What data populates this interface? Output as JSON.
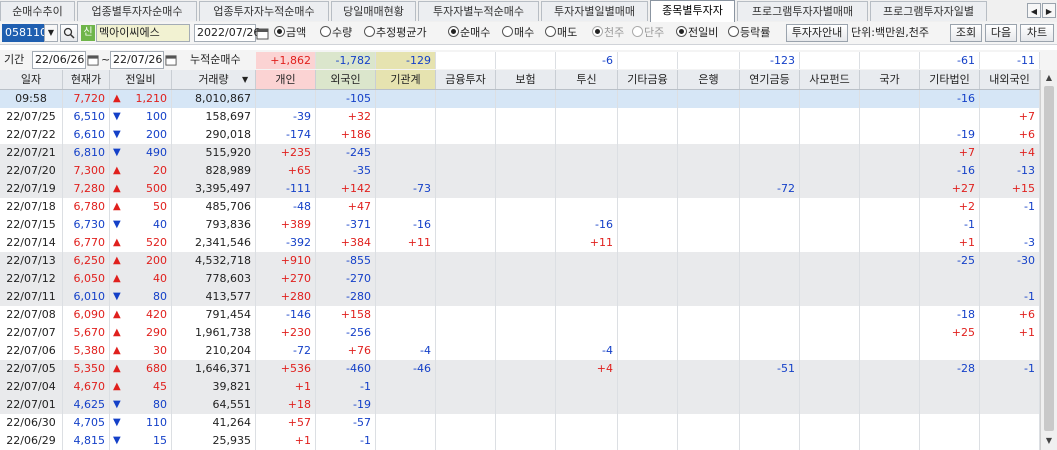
{
  "tabs": [
    "순매수추이",
    "업종별투자자순매수",
    "업종투자자누적순매수",
    "당일매매현황",
    "투자자별누적순매수",
    "투자자별일별매매",
    "종목별투자자",
    "프로그램투자자별매매",
    "프로그램투자자일별"
  ],
  "active_tab": 6,
  "toolbar": {
    "stock_code": "058110",
    "stock_badge": "신",
    "stock_name": "멕아이씨에스",
    "date": "2022/07/26",
    "opt1": [
      "금액",
      "수량",
      "추정평균가"
    ],
    "opt2": [
      "순매수",
      "매수",
      "매도"
    ],
    "opt3": [
      "천주",
      "단주"
    ],
    "opt4": [
      "전일비",
      "등락률"
    ],
    "investor_info_btn": "투자자안내",
    "unit_label": "단위:백만원,천주",
    "query_btn": "조회",
    "next_btn": "다음",
    "chart_btn": "차트"
  },
  "period": {
    "label": "기간",
    "from": "22/06/26",
    "to": "22/07/26",
    "cum_label": "누적순매수",
    "sums": [
      "+1,862",
      "-1,782",
      "-129",
      "",
      "",
      "-6",
      "",
      "",
      "-123",
      "",
      "",
      "-61",
      "-11"
    ]
  },
  "columns": [
    "일자",
    "현재가",
    "전일비",
    "거래량",
    "개인",
    "외국인",
    "기관계",
    "금융투자",
    "보험",
    "투신",
    "기타금융",
    "은행",
    "연기금등",
    "사모펀드",
    "국가",
    "기타법인",
    "내외국인"
  ],
  "accent": {
    "up": "#e0201d",
    "down": "#1440c8",
    "highlight": "#d6e6f6",
    "shade": "#e9eaec"
  },
  "rows": [
    {
      "date": "09:58",
      "price": "7,720",
      "dir": "up",
      "chg": "1,210",
      "vol": "8,010,867",
      "vals": [
        "",
        "-105",
        "",
        "",
        "",
        "",
        "",
        "",
        "",
        "",
        "",
        "-16",
        ""
      ]
    },
    {
      "date": "22/07/25",
      "price": "6,510",
      "dir": "down",
      "chg": "100",
      "vol": "158,697",
      "vals": [
        "-39",
        "+32",
        "",
        "",
        "",
        "",
        "",
        "",
        "",
        "",
        "",
        "",
        "+7"
      ]
    },
    {
      "date": "22/07/22",
      "price": "6,610",
      "dir": "down",
      "chg": "200",
      "vol": "290,018",
      "vals": [
        "-174",
        "+186",
        "",
        "",
        "",
        "",
        "",
        "",
        "",
        "",
        "",
        "-19",
        "+6"
      ]
    },
    {
      "date": "22/07/21",
      "price": "6,810",
      "dir": "down",
      "chg": "490",
      "vol": "515,920",
      "vals": [
        "+235",
        "-245",
        "",
        "",
        "",
        "",
        "",
        "",
        "",
        "",
        "",
        "+7",
        "+4"
      ]
    },
    {
      "date": "22/07/20",
      "price": "7,300",
      "dir": "up",
      "chg": "20",
      "vol": "828,989",
      "vals": [
        "+65",
        "-35",
        "",
        "",
        "",
        "",
        "",
        "",
        "",
        "",
        "",
        "-16",
        "-13"
      ]
    },
    {
      "date": "22/07/19",
      "price": "7,280",
      "dir": "up",
      "chg": "500",
      "vol": "3,395,497",
      "vals": [
        "-111",
        "+142",
        "-73",
        "",
        "",
        "",
        "",
        "",
        "-72",
        "",
        "",
        "+27",
        "+15"
      ]
    },
    {
      "date": "22/07/18",
      "price": "6,780",
      "dir": "up",
      "chg": "50",
      "vol": "485,706",
      "vals": [
        "-48",
        "+47",
        "",
        "",
        "",
        "",
        "",
        "",
        "",
        "",
        "",
        "+2",
        "-1"
      ]
    },
    {
      "date": "22/07/15",
      "price": "6,730",
      "dir": "down",
      "chg": "40",
      "vol": "793,836",
      "vals": [
        "+389",
        "-371",
        "-16",
        "",
        "",
        "-16",
        "",
        "",
        "",
        "",
        "",
        "-1",
        ""
      ]
    },
    {
      "date": "22/07/14",
      "price": "6,770",
      "dir": "up",
      "chg": "520",
      "vol": "2,341,546",
      "vals": [
        "-392",
        "+384",
        "+11",
        "",
        "",
        "+11",
        "",
        "",
        "",
        "",
        "",
        "+1",
        "-3"
      ]
    },
    {
      "date": "22/07/13",
      "price": "6,250",
      "dir": "up",
      "chg": "200",
      "vol": "4,532,718",
      "vals": [
        "+910",
        "-855",
        "",
        "",
        "",
        "",
        "",
        "",
        "",
        "",
        "",
        "-25",
        "-30"
      ]
    },
    {
      "date": "22/07/12",
      "price": "6,050",
      "dir": "up",
      "chg": "40",
      "vol": "778,603",
      "vals": [
        "+270",
        "-270",
        "",
        "",
        "",
        "",
        "",
        "",
        "",
        "",
        "",
        "",
        ""
      ]
    },
    {
      "date": "22/07/11",
      "price": "6,010",
      "dir": "down",
      "chg": "80",
      "vol": "413,577",
      "vals": [
        "+280",
        "-280",
        "",
        "",
        "",
        "",
        "",
        "",
        "",
        "",
        "",
        "",
        "-1"
      ]
    },
    {
      "date": "22/07/08",
      "price": "6,090",
      "dir": "up",
      "chg": "420",
      "vol": "791,454",
      "vals": [
        "-146",
        "+158",
        "",
        "",
        "",
        "",
        "",
        "",
        "",
        "",
        "",
        "-18",
        "+6"
      ]
    },
    {
      "date": "22/07/07",
      "price": "5,670",
      "dir": "up",
      "chg": "290",
      "vol": "1,961,738",
      "vals": [
        "+230",
        "-256",
        "",
        "",
        "",
        "",
        "",
        "",
        "",
        "",
        "",
        "+25",
        "+1"
      ]
    },
    {
      "date": "22/07/06",
      "price": "5,380",
      "dir": "up",
      "chg": "30",
      "vol": "210,204",
      "vals": [
        "-72",
        "+76",
        "-4",
        "",
        "",
        "-4",
        "",
        "",
        "",
        "",
        "",
        "",
        ""
      ]
    },
    {
      "date": "22/07/05",
      "price": "5,350",
      "dir": "up",
      "chg": "680",
      "vol": "1,646,371",
      "vals": [
        "+536",
        "-460",
        "-46",
        "",
        "",
        "+4",
        "",
        "",
        "-51",
        "",
        "",
        "-28",
        "-1"
      ]
    },
    {
      "date": "22/07/04",
      "price": "4,670",
      "dir": "up",
      "chg": "45",
      "vol": "39,821",
      "vals": [
        "+1",
        "-1",
        "",
        "",
        "",
        "",
        "",
        "",
        "",
        "",
        "",
        "",
        ""
      ]
    },
    {
      "date": "22/07/01",
      "price": "4,625",
      "dir": "down",
      "chg": "80",
      "vol": "64,551",
      "vals": [
        "+18",
        "-19",
        "",
        "",
        "",
        "",
        "",
        "",
        "",
        "",
        "",
        "",
        ""
      ]
    },
    {
      "date": "22/06/30",
      "price": "4,705",
      "dir": "down",
      "chg": "110",
      "vol": "41,264",
      "vals": [
        "+57",
        "-57",
        "",
        "",
        "",
        "",
        "",
        "",
        "",
        "",
        "",
        "",
        ""
      ]
    },
    {
      "date": "22/06/29",
      "price": "4,815",
      "dir": "down",
      "chg": "15",
      "vol": "25,935",
      "vals": [
        "+1",
        "-1",
        "",
        "",
        "",
        "",
        "",
        "",
        "",
        "",
        "",
        "",
        ""
      ]
    }
  ]
}
